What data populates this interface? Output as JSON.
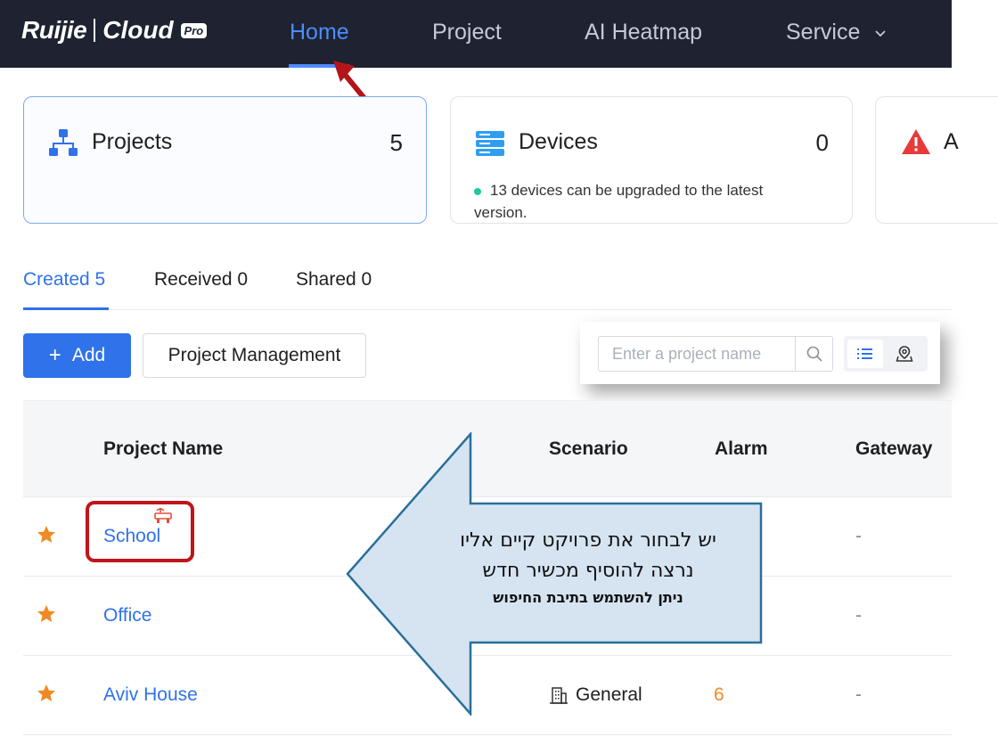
{
  "brand": {
    "ruijie": "Ruijie",
    "cloud": "Cloud",
    "pro": "Pro"
  },
  "nav": {
    "home": "Home",
    "project": "Project",
    "ai_heatmap": "AI Heatmap",
    "service": "Service"
  },
  "cards": {
    "projects": {
      "title": "Projects",
      "count": "5"
    },
    "devices": {
      "title": "Devices",
      "count": "0",
      "note": "13 devices can be upgraded to the latest version."
    },
    "alarms": {
      "title": "A"
    }
  },
  "tabs": {
    "created": "Created 5",
    "received": "Received 0",
    "shared": "Shared 0"
  },
  "toolbar": {
    "add_label": "Add",
    "add_icon": "+",
    "project_management": "Project Management",
    "search_placeholder": "Enter a project name"
  },
  "table": {
    "headers": {
      "project_name": "Project Name",
      "scenario": "Scenario",
      "alarm": "Alarm",
      "gateway": "Gateway"
    },
    "rows": [
      {
        "name": "School",
        "scenario": "",
        "alarm": "",
        "gateway": "-"
      },
      {
        "name": "Office",
        "scenario": "",
        "alarm": "",
        "gateway": "-"
      },
      {
        "name": "Aviv House",
        "scenario": "General",
        "alarm": "6",
        "gateway": "-"
      }
    ]
  },
  "callout": {
    "line1": "יש לבחור את פרויקט קיים אליו",
    "line2": "נרצה להוסיף מכשיר חדש",
    "line3": "ניתן להשתמש בתיבת החיפוש"
  },
  "colors": {
    "topbar": "#1e2231",
    "accent": "#2f72ea",
    "star": "#f08a24",
    "alarm": "#f08a24",
    "highlight": "#c0151a",
    "callout_fill": "#d6e4f2",
    "callout_stroke": "#2a6f9a"
  }
}
